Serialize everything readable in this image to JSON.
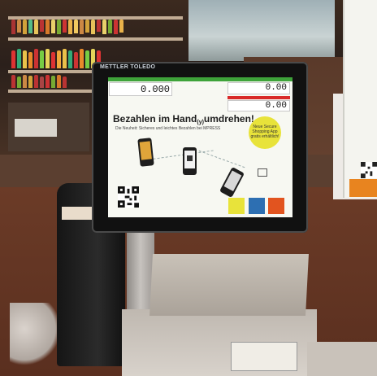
{
  "monitor": {
    "brand": "METTLER TOLEDO"
  },
  "screen": {
    "weight_value": "0.000",
    "price_top": "0.00",
    "price_bottom": "0.00",
    "headline_a": "Bezahlen im Hand",
    "headline_b": "(y)",
    "headline_c": "umdrehen!",
    "subline": "Die Neuheit: Sicheres und leichtes Bezahlen bei MPRESS",
    "badge": "Neue Secure Shopping App gratis erhältlich!"
  },
  "colors": {
    "status_green": "#3ea33a",
    "alert_red": "#d92a2a",
    "badge_yellow": "#e8e33a",
    "accent_orange": "#e8841f"
  }
}
